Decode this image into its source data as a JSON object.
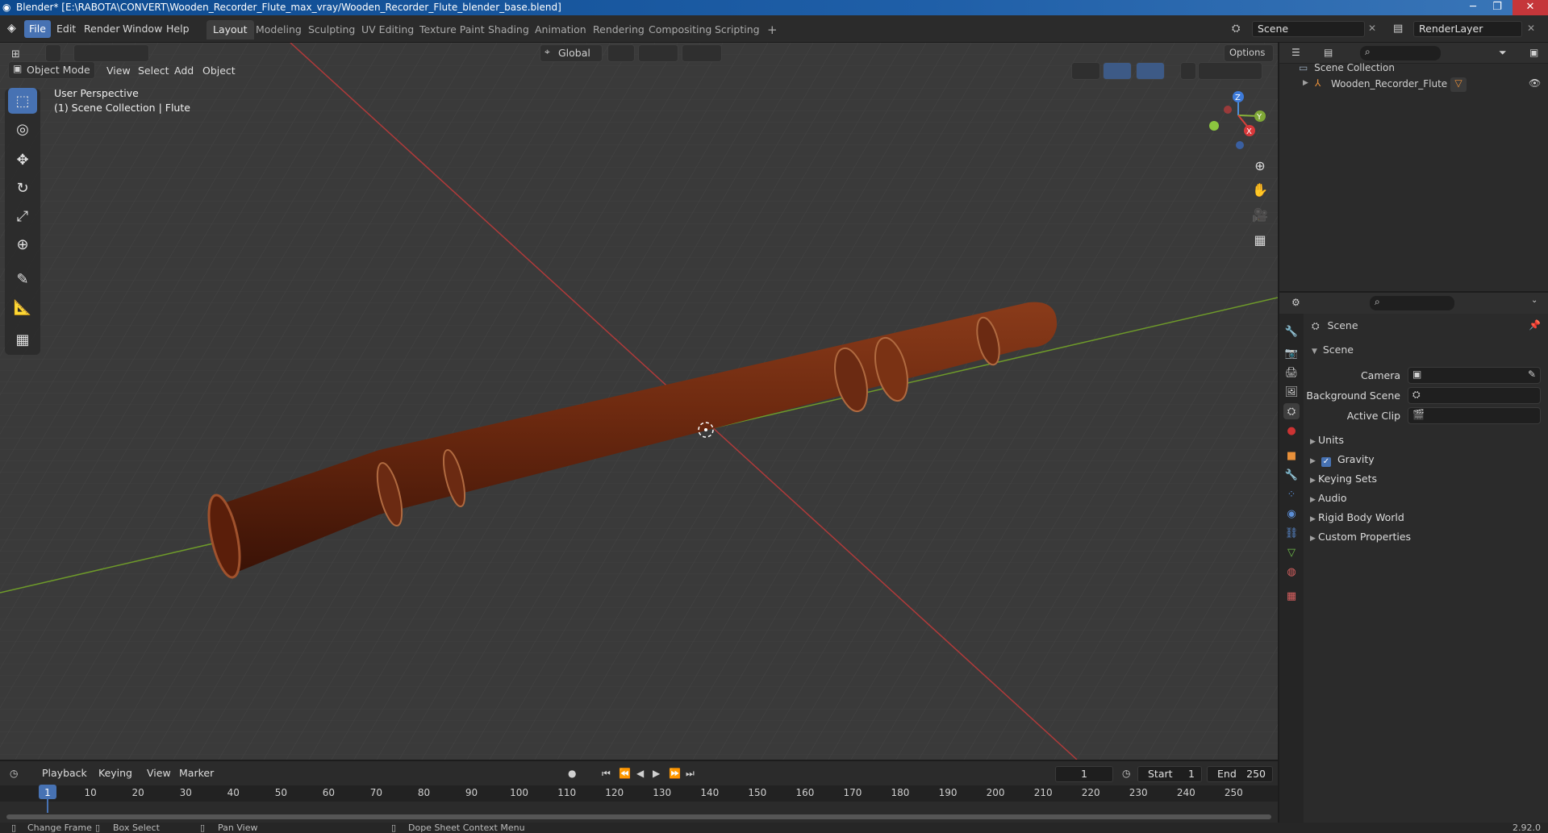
{
  "window": {
    "title": "Blender* [E:\\RABOTA\\CONVERT\\Wooden_Recorder_Flute_max_vray/Wooden_Recorder_Flute_blender_base.blend]",
    "buttons": [
      "─",
      "❐",
      "✕"
    ]
  },
  "menu": [
    "File",
    "Edit",
    "Render",
    "Window",
    "Help"
  ],
  "workspaces": [
    "Layout",
    "Modeling",
    "Sculpting",
    "UV Editing",
    "Texture Paint",
    "Shading",
    "Animation",
    "Rendering",
    "Compositing",
    "Scripting",
    "+"
  ],
  "scene_field": "Scene",
  "renderlayer_field": "RenderLayer",
  "viewport_header": {
    "mode": "Object Mode",
    "menus": [
      "View",
      "Select",
      "Add",
      "Object"
    ],
    "orientation": "Global",
    "options": "Options"
  },
  "viewport": {
    "perspective": "User Perspective",
    "collection": "(1) Scene Collection | Flute",
    "gizmo_axes": [
      "Z",
      "Y",
      "X"
    ]
  },
  "outliner": {
    "root": "Scene Collection",
    "items": [
      {
        "label": "Wooden_Recorder_Flute"
      }
    ]
  },
  "properties": {
    "context": "Scene",
    "panel": "Scene",
    "fields": [
      {
        "label": "Camera"
      },
      {
        "label": "Background Scene"
      },
      {
        "label": "Active Clip"
      }
    ],
    "sections": [
      "Units",
      "Gravity",
      "Keying Sets",
      "Audio",
      "Rigid Body World",
      "Custom Properties"
    ]
  },
  "timeline": {
    "menus": [
      "Playback",
      "Keying",
      "View",
      "Marker"
    ],
    "current_frame": "1",
    "start_label": "Start",
    "start": "1",
    "end_label": "End",
    "end": "250",
    "ruler": [
      "1",
      "10",
      "20",
      "30",
      "40",
      "50",
      "60",
      "70",
      "80",
      "90",
      "100",
      "110",
      "120",
      "130",
      "140",
      "150",
      "160",
      "170",
      "180",
      "190",
      "200",
      "210",
      "220",
      "230",
      "240",
      "250"
    ]
  },
  "status": {
    "items": [
      "Change Frame",
      "Box Select",
      "Pan View",
      "Dope Sheet Context Menu"
    ],
    "version": "2.92.0"
  }
}
